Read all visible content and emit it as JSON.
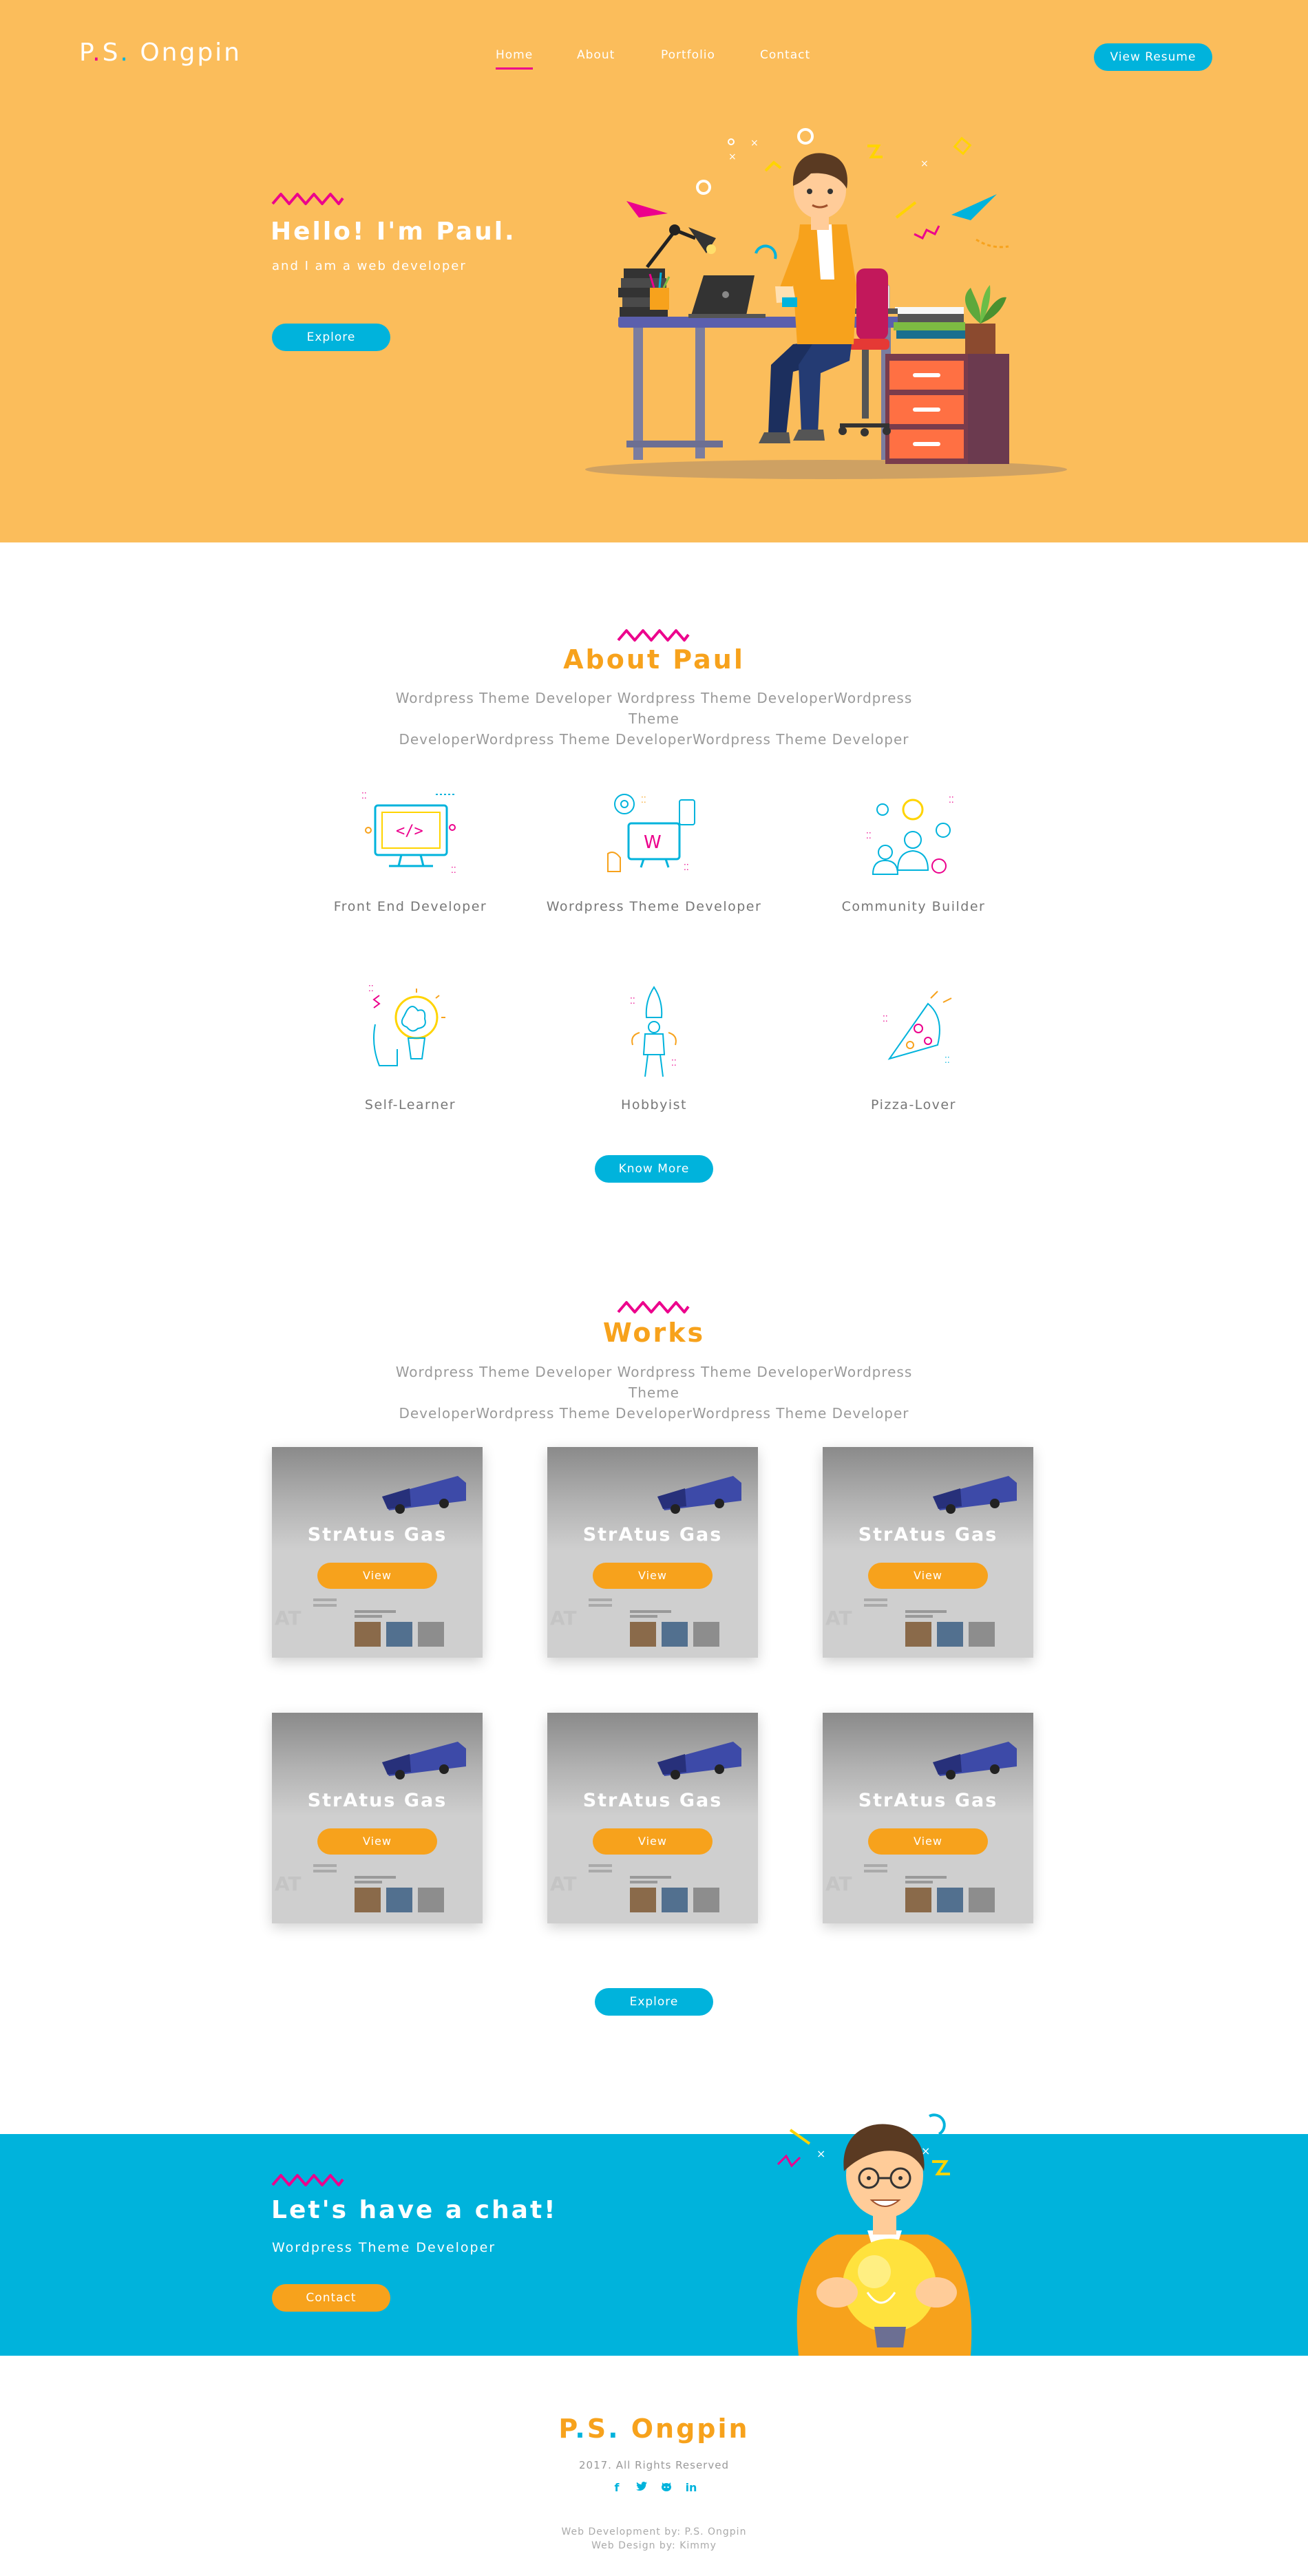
{
  "brand": {
    "name_part1": "P",
    "name_part2": "S",
    "name_part3": "Ongpin"
  },
  "nav": {
    "home": "Home",
    "about": "About",
    "portfolio": "Portfolio",
    "contact": "Contact",
    "resume": "View Resume"
  },
  "hero": {
    "title": "Hello! I'm Paul.",
    "subtitle": "and I am a web developer",
    "button": "Explore"
  },
  "about": {
    "title": "About Paul",
    "desc_line1": "Wordpress Theme Developer Wordpress Theme DeveloperWordpress Theme",
    "desc_line2": "DeveloperWordpress Theme DeveloperWordpress Theme Developer",
    "skills": [
      {
        "label": "Front End Developer",
        "icon": "code-monitor-icon"
      },
      {
        "label": "Wordpress Theme Developer",
        "icon": "wordpress-icon"
      },
      {
        "label": "Community Builder",
        "icon": "community-icon"
      },
      {
        "label": "Self-Learner",
        "icon": "brain-icon"
      },
      {
        "label": "Hobbyist",
        "icon": "rocket-icon"
      },
      {
        "label": "Pizza-Lover",
        "icon": "pizza-icon"
      }
    ],
    "button": "Know More"
  },
  "works": {
    "title": "Works",
    "desc_line1": "Wordpress Theme Developer Wordpress Theme DeveloperWordpress Theme",
    "desc_line2": "DeveloperWordpress Theme DeveloperWordpress Theme Developer",
    "items": [
      {
        "title": "StrAtus Gas",
        "button": "View"
      },
      {
        "title": "StrAtus Gas",
        "button": "View"
      },
      {
        "title": "StrAtus Gas",
        "button": "View"
      },
      {
        "title": "StrAtus Gas",
        "button": "View"
      },
      {
        "title": "StrAtus Gas",
        "button": "View"
      },
      {
        "title": "StrAtus Gas",
        "button": "View"
      }
    ],
    "button": "Explore"
  },
  "chat": {
    "title": "Let's have a chat!",
    "subtitle": "Wordpress Theme Developer",
    "button": "Contact"
  },
  "footer": {
    "logo_part1": "P",
    "logo_part2": "S",
    "logo_part3": "Ongpin",
    "copyright": "2017. All Rights Reserved",
    "credit_dev": "Web Development by: P.S. Ongpin",
    "credit_design": "Web Design by: Kimmy",
    "social": [
      "facebook-icon",
      "twitter-icon",
      "github-icon",
      "linkedin-icon"
    ]
  },
  "colors": {
    "hero_bg": "#fbbd5b",
    "accent_blue": "#00b3dc",
    "accent_orange": "#f7a21c",
    "accent_pink": "#ec008c"
  }
}
